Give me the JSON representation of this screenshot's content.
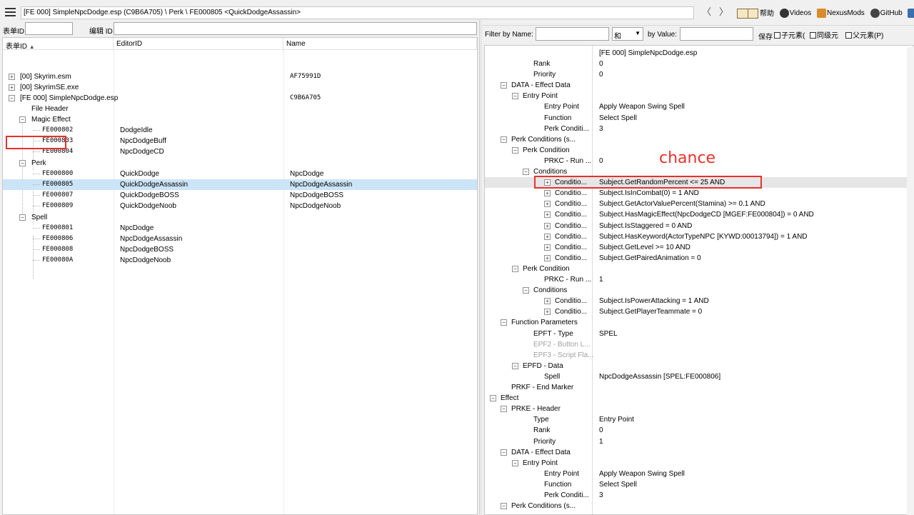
{
  "topbar": {
    "path": "[FE 000] SimpleNpcDodge.esp (C9B6A705) \\ Perk \\ FE000805 <QuickDodgeAssassin>",
    "back_label": "〈",
    "forward_label": "〉",
    "links": {
      "help": "帮助",
      "videos": "Videos",
      "nexus": "NexusMods",
      "github": "GitHub",
      "more": "D"
    }
  },
  "left": {
    "filter_formid_label": "表单ID",
    "filter_editorid_label": "编辑 ID",
    "columns": {
      "formid": "表单ID",
      "editorid": "EditorID",
      "name": "Name"
    },
    "sort_indicator": "▲",
    "tree": {
      "skyrim_esm": {
        "formid": "[00] Skyrim.esm",
        "name": "AF75991D"
      },
      "skyrimse_exe": {
        "formid": "[00] SkyrimSE.exe"
      },
      "plugin": {
        "formid": "[FE 000] SimpleNpcDodge.esp",
        "name": "C9B6A705"
      },
      "file_header": "File Header",
      "magic_effect": "Magic Effect",
      "perk": "Perk",
      "spell": "Spell",
      "mgef_rows": [
        {
          "formid": "FE000802",
          "editorid": "DodgeIdle",
          "name": ""
        },
        {
          "formid": "FE000803",
          "editorid": "NpcDodgeBuff",
          "name": ""
        },
        {
          "formid": "FE000804",
          "editorid": "NpcDodgeCD",
          "name": ""
        }
      ],
      "perk_rows": [
        {
          "formid": "FE000800",
          "editorid": "QuickDodge",
          "name": "NpcDodge"
        },
        {
          "formid": "FE000805",
          "editorid": "QuickDodgeAssassin",
          "name": "NpcDodgeAssassin"
        },
        {
          "formid": "FE000807",
          "editorid": "QuickDodgeBOSS",
          "name": "NpcDodgeBOSS"
        },
        {
          "formid": "FE000809",
          "editorid": "QuickDodgeNoob",
          "name": "NpcDodgeNoob"
        }
      ],
      "spel_rows": [
        {
          "formid": "FE000801",
          "editorid": "NpcDodge",
          "name": ""
        },
        {
          "formid": "FE000806",
          "editorid": "NpcDodgeAssassin",
          "name": ""
        },
        {
          "formid": "FE000808",
          "editorid": "NpcDodgeBOSS",
          "name": ""
        },
        {
          "formid": "FE00080A",
          "editorid": "NpcDodgeNoob",
          "name": ""
        }
      ]
    }
  },
  "right": {
    "filter_name_label": "Filter by Name:",
    "filter_op": "和",
    "filter_value_label": "by Value:",
    "keep_label": "保存",
    "chk_children": "子元素(",
    "chk_siblings": "同级元",
    "chk_parents": "父元素(P)",
    "file_label": "[FE 000] SimpleNpcDodge.esp",
    "rows": [
      {
        "label": "Rank",
        "value": "0"
      },
      {
        "label": "Priority",
        "value": "0"
      },
      {
        "label": "DATA - Effect Data",
        "value": ""
      },
      {
        "label": "Entry Point",
        "value": ""
      },
      {
        "label": "Entry Point",
        "value": "Apply Weapon Swing Spell"
      },
      {
        "label": "Function",
        "value": "Select Spell"
      },
      {
        "label": "Perk Conditi...",
        "value": "3"
      },
      {
        "label": "Perk Conditions (s...",
        "value": ""
      },
      {
        "label": "Perk Condition",
        "value": ""
      },
      {
        "label": "PRKC - Run ...",
        "value": "0"
      },
      {
        "label": "Conditions",
        "value": ""
      },
      {
        "label": "Conditio...",
        "value": "Subject.GetRandomPercent <= 25 AND"
      },
      {
        "label": "Conditio...",
        "value": "Subject.IsInCombat(0) = 1 AND"
      },
      {
        "label": "Conditio...",
        "value": "Subject.GetActorValuePercent(Stamina) >= 0.1 AND"
      },
      {
        "label": "Conditio...",
        "value": "Subject.HasMagicEffect(NpcDodgeCD [MGEF:FE000804]) = 0 AND"
      },
      {
        "label": "Conditio...",
        "value": "Subject.IsStaggered = 0 AND"
      },
      {
        "label": "Conditio...",
        "value": "Subject.HasKeyword(ActorTypeNPC [KYWD:00013794]) = 1 AND"
      },
      {
        "label": "Conditio...",
        "value": "Subject.GetLevel >= 10 AND"
      },
      {
        "label": "Conditio...",
        "value": "Subject.GetPairedAnimation = 0"
      },
      {
        "label": "Perk Condition",
        "value": ""
      },
      {
        "label": "PRKC - Run ...",
        "value": "1"
      },
      {
        "label": "Conditions",
        "value": ""
      },
      {
        "label": "Conditio...",
        "value": "Subject.IsPowerAttacking = 1 AND"
      },
      {
        "label": "Conditio...",
        "value": "Subject.GetPlayerTeammate = 0"
      },
      {
        "label": "Function Parameters",
        "value": ""
      },
      {
        "label": "EPFT - Type",
        "value": "SPEL"
      },
      {
        "label": "EPF2 - Button L...",
        "value": ""
      },
      {
        "label": "EPF3 - Script Fla...",
        "value": ""
      },
      {
        "label": "EPFD - Data",
        "value": ""
      },
      {
        "label": "Spell",
        "value": "NpcDodgeAssassin [SPEL:FE000806]"
      },
      {
        "label": "PRKF - End Marker",
        "value": ""
      },
      {
        "label": "Effect",
        "value": ""
      },
      {
        "label": "PRKE - Header",
        "value": ""
      },
      {
        "label": "Type",
        "value": "Entry Point"
      },
      {
        "label": "Rank",
        "value": "0"
      },
      {
        "label": "Priority",
        "value": "1"
      },
      {
        "label": "DATA - Effect Data",
        "value": ""
      },
      {
        "label": "Entry Point",
        "value": ""
      },
      {
        "label": "Entry Point",
        "value": "Apply Weapon Swing Spell"
      },
      {
        "label": "Function",
        "value": "Select Spell"
      },
      {
        "label": "Perk Conditi...",
        "value": "3"
      },
      {
        "label": "Perk Conditions (s...",
        "value": ""
      }
    ]
  },
  "annotation": {
    "text": "chance",
    "color": "#e8302c"
  },
  "colors": {
    "selection": "#cce4f7",
    "annotation": "#e8302c",
    "chrome": "#f0f0f0"
  }
}
